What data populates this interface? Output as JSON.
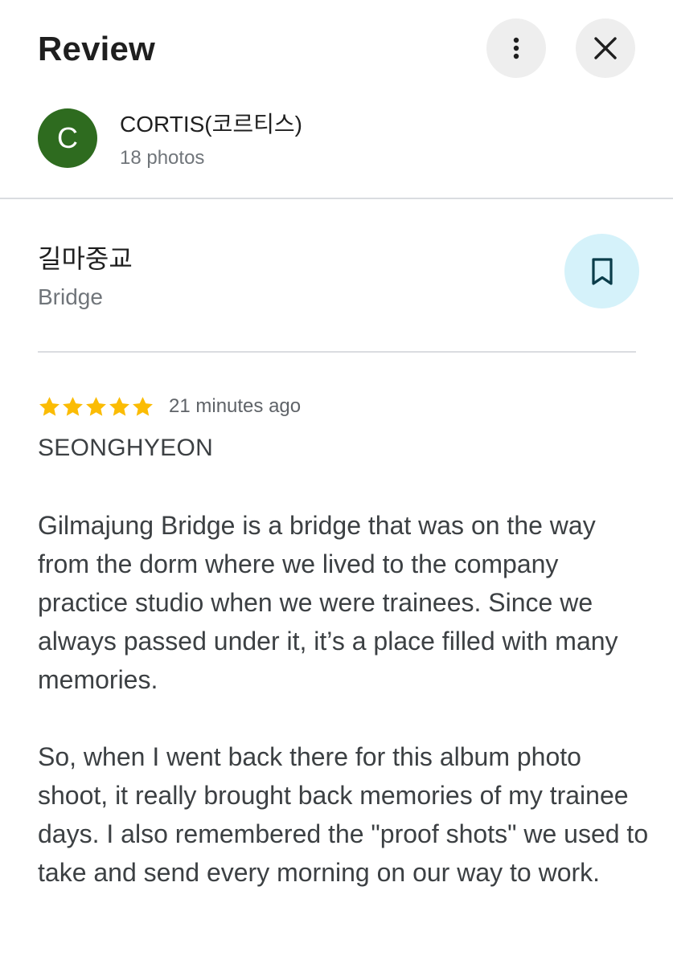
{
  "header": {
    "title": "Review",
    "more_icon": "more-vertical-icon",
    "close_icon": "close-icon"
  },
  "author": {
    "avatar_letter": "C",
    "avatar_color": "#2e6b1f",
    "name": "CORTIS(코르티스)",
    "meta": "18 photos"
  },
  "place": {
    "name": "길마중교",
    "type": "Bridge",
    "save_icon": "bookmark-icon",
    "save_bg": "#d5f2fa"
  },
  "review": {
    "rating": 5,
    "max_rating": 5,
    "star_color": "#fbbc04",
    "time": "21 minutes ago",
    "reviewer": "SEONGHYEON",
    "paragraphs": [
      "Gilmajung Bridge is a bridge that was on the way from the dorm where we lived to the company practice studio when we were trainees. Since we always passed under it, it’s a place filled with many memories.",
      "So, when I went back there for this album photo shoot, it really brought back memories of my trainee days. I also remembered the \"proof shots\" we used to take and send every morning on our way to work."
    ]
  }
}
